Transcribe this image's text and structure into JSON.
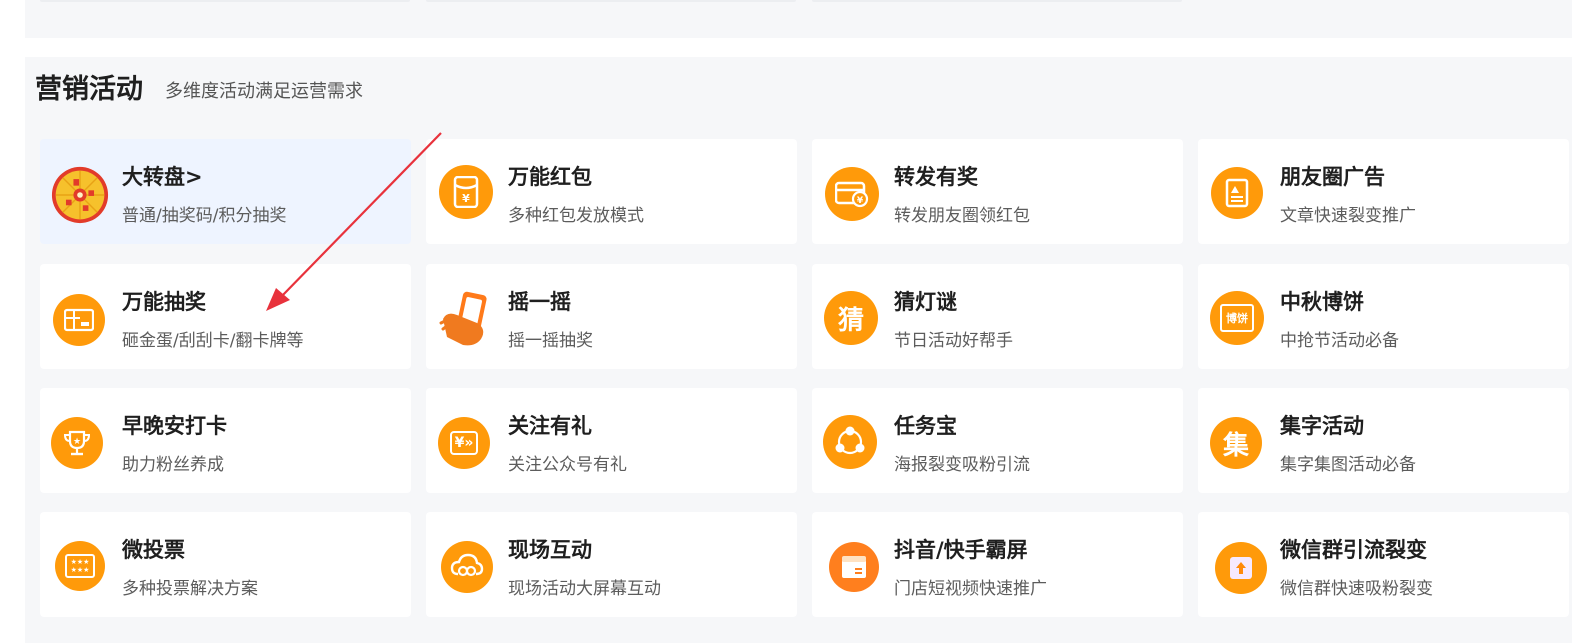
{
  "section": {
    "title": "营销活动",
    "subtitle": "多维度活动满足运营需求"
  },
  "cards": [
    {
      "title": "大转盘>",
      "desc": "普通/抽奖码/积分抽奖",
      "icon": "wheel-icon",
      "active": true
    },
    {
      "title": "万能红包",
      "desc": "多种红包发放模式",
      "icon": "red-envelope-icon"
    },
    {
      "title": "转发有奖",
      "desc": "转发朋友圈领红包",
      "icon": "share-reward-icon"
    },
    {
      "title": "朋友圈广告",
      "desc": "文章快速裂变推广",
      "icon": "moments-ad-icon"
    },
    {
      "title": "万能抽奖",
      "desc": "砸金蛋/刮刮卡/翻卡牌等",
      "icon": "gift-card-icon"
    },
    {
      "title": "摇一摇",
      "desc": "摇一摇抽奖",
      "icon": "phone-shake-icon"
    },
    {
      "title": "猜灯谜",
      "desc": "节日活动好帮手",
      "icon": "guess-icon",
      "icon_text": "猜"
    },
    {
      "title": "中秋博饼",
      "desc": "中抢节活动必备",
      "icon": "mooncake-icon",
      "icon_text": "博饼"
    },
    {
      "title": "早晚安打卡",
      "desc": "助力粉丝养成",
      "icon": "trophy-icon"
    },
    {
      "title": "关注有礼",
      "desc": "关注公众号有礼",
      "icon": "follow-gift-icon",
      "icon_text": "¥»"
    },
    {
      "title": "任务宝",
      "desc": "海报裂变吸粉引流",
      "icon": "share-network-icon"
    },
    {
      "title": "集字活动",
      "desc": "集字集图活动必备",
      "icon": "collect-word-icon",
      "icon_text": "集"
    },
    {
      "title": "微投票",
      "desc": "多种投票解决方案",
      "icon": "vote-icon",
      "icon_text": "★★★"
    },
    {
      "title": "现场互动",
      "desc": "现场活动大屏幕互动",
      "icon": "cloud-link-icon"
    },
    {
      "title": "抖音/快手霸屏",
      "desc": "门店短视频快速推广",
      "icon": "video-box-icon"
    },
    {
      "title": "微信群引流裂变",
      "desc": "微信群快速吸粉裂变",
      "icon": "group-upload-icon"
    }
  ],
  "colors": {
    "accent": "#ff9a0a",
    "arrow": "#e8323c",
    "active_card": "#eef4ff"
  }
}
